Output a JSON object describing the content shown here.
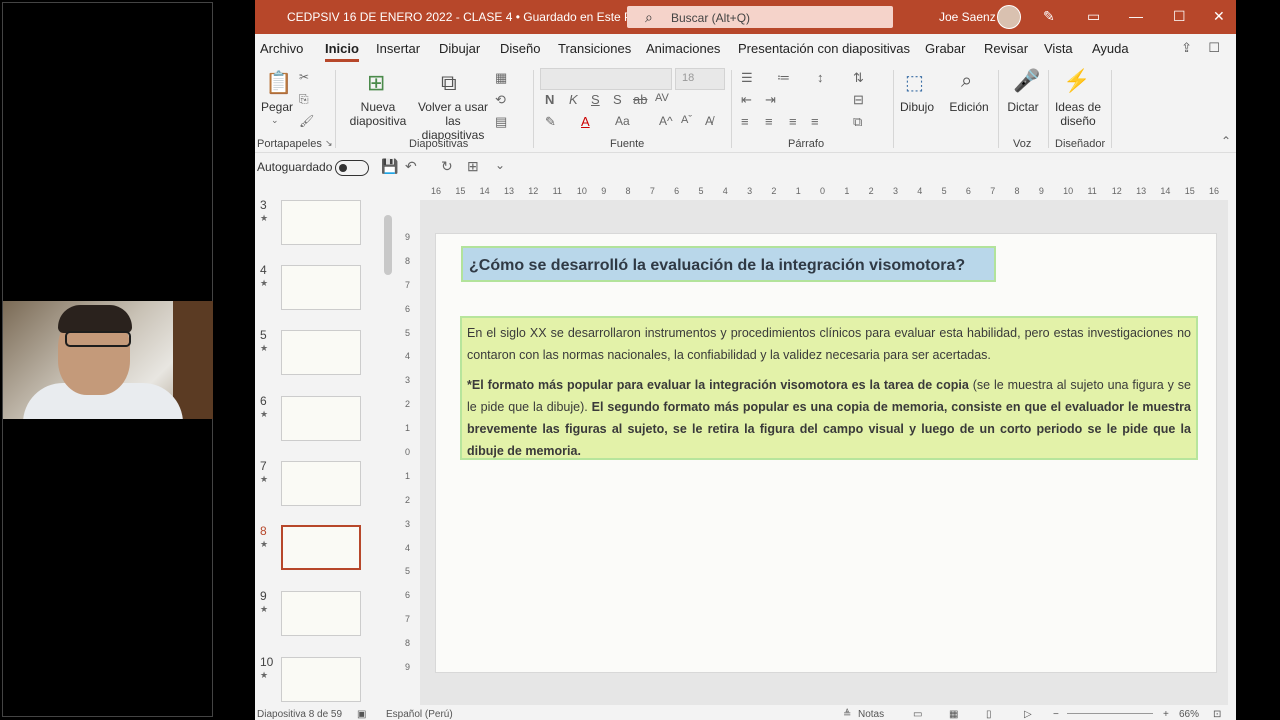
{
  "titlebar": {
    "title": "CEDPSIV 16 DE ENERO 2022 - CLASE 4 • Guardado en Este PC ⌄",
    "search_placeholder": "Buscar (Alt+Q)",
    "user": "Joe Saenz"
  },
  "tabs": [
    "Archivo",
    "Inicio",
    "Insertar",
    "Dibujar",
    "Diseño",
    "Transiciones",
    "Animaciones",
    "Presentación con diapositivas",
    "Grabar",
    "Revisar",
    "Vista",
    "Ayuda"
  ],
  "ribbon": {
    "paste": "Pegar",
    "clipboard_group": "Portapapeles",
    "new_slide": "Nueva diapositiva",
    "reuse_slides": "Volver a usar las diapositivas",
    "slides_group": "Diapositivas",
    "font_size": "18",
    "font_group": "Fuente",
    "paragraph_group": "Párrafo",
    "drawing": "Dibujo",
    "editing": "Edición",
    "dictate": "Dictar",
    "voice_group": "Voz",
    "design_ideas": "Ideas de diseño",
    "designer_group": "Diseñador"
  },
  "qat": {
    "autosave": "Autoguardado"
  },
  "thumbnails": [
    "3",
    "4",
    "5",
    "6",
    "7",
    "8",
    "9",
    "10"
  ],
  "active_thumbnail": "8",
  "ruler_h": [
    "16",
    "15",
    "14",
    "13",
    "12",
    "11",
    "10",
    "9",
    "8",
    "7",
    "6",
    "5",
    "4",
    "3",
    "2",
    "1",
    "0",
    "1",
    "2",
    "3",
    "4",
    "5",
    "6",
    "7",
    "8",
    "9",
    "10",
    "11",
    "12",
    "13",
    "14",
    "15",
    "16"
  ],
  "ruler_v": [
    "9",
    "8",
    "7",
    "6",
    "5",
    "4",
    "3",
    "2",
    "1",
    "0",
    "1",
    "2",
    "3",
    "4",
    "5",
    "6",
    "7",
    "8",
    "9"
  ],
  "slide": {
    "title": "¿Cómo se desarrolló la evaluación de la integración visomotora?",
    "p1": "En el siglo XX se desarrollaron instrumentos y procedimientos clínicos para evaluar esta habilidad, pero estas investigaciones no contaron con las normas nacionales, la confiabilidad y la validez necesaria para ser acertadas.",
    "p2_bold1": "*El formato más popular para evaluar la integración visomotora es la tarea de copia",
    "p2_normal": " (se le muestra al sujeto una figura y se le pide que la dibuje). ",
    "p2_bold2": "El segundo formato más popular es una copia de memoria, consiste en que el  evaluador le muestra brevemente las figuras al sujeto, se le retira la figura del campo visual y luego de un corto periodo se le pide que la dibuje de memoria."
  },
  "status": {
    "slide_info": "Diapositiva 8 de 59",
    "language": "Español (Perú)",
    "notes": "Notas",
    "zoom": "66%"
  },
  "colors": {
    "accent": "#b7472a",
    "title_box": "#b9d7ea",
    "body_box": "#e3f2a9",
    "box_border": "#b2e39b"
  }
}
